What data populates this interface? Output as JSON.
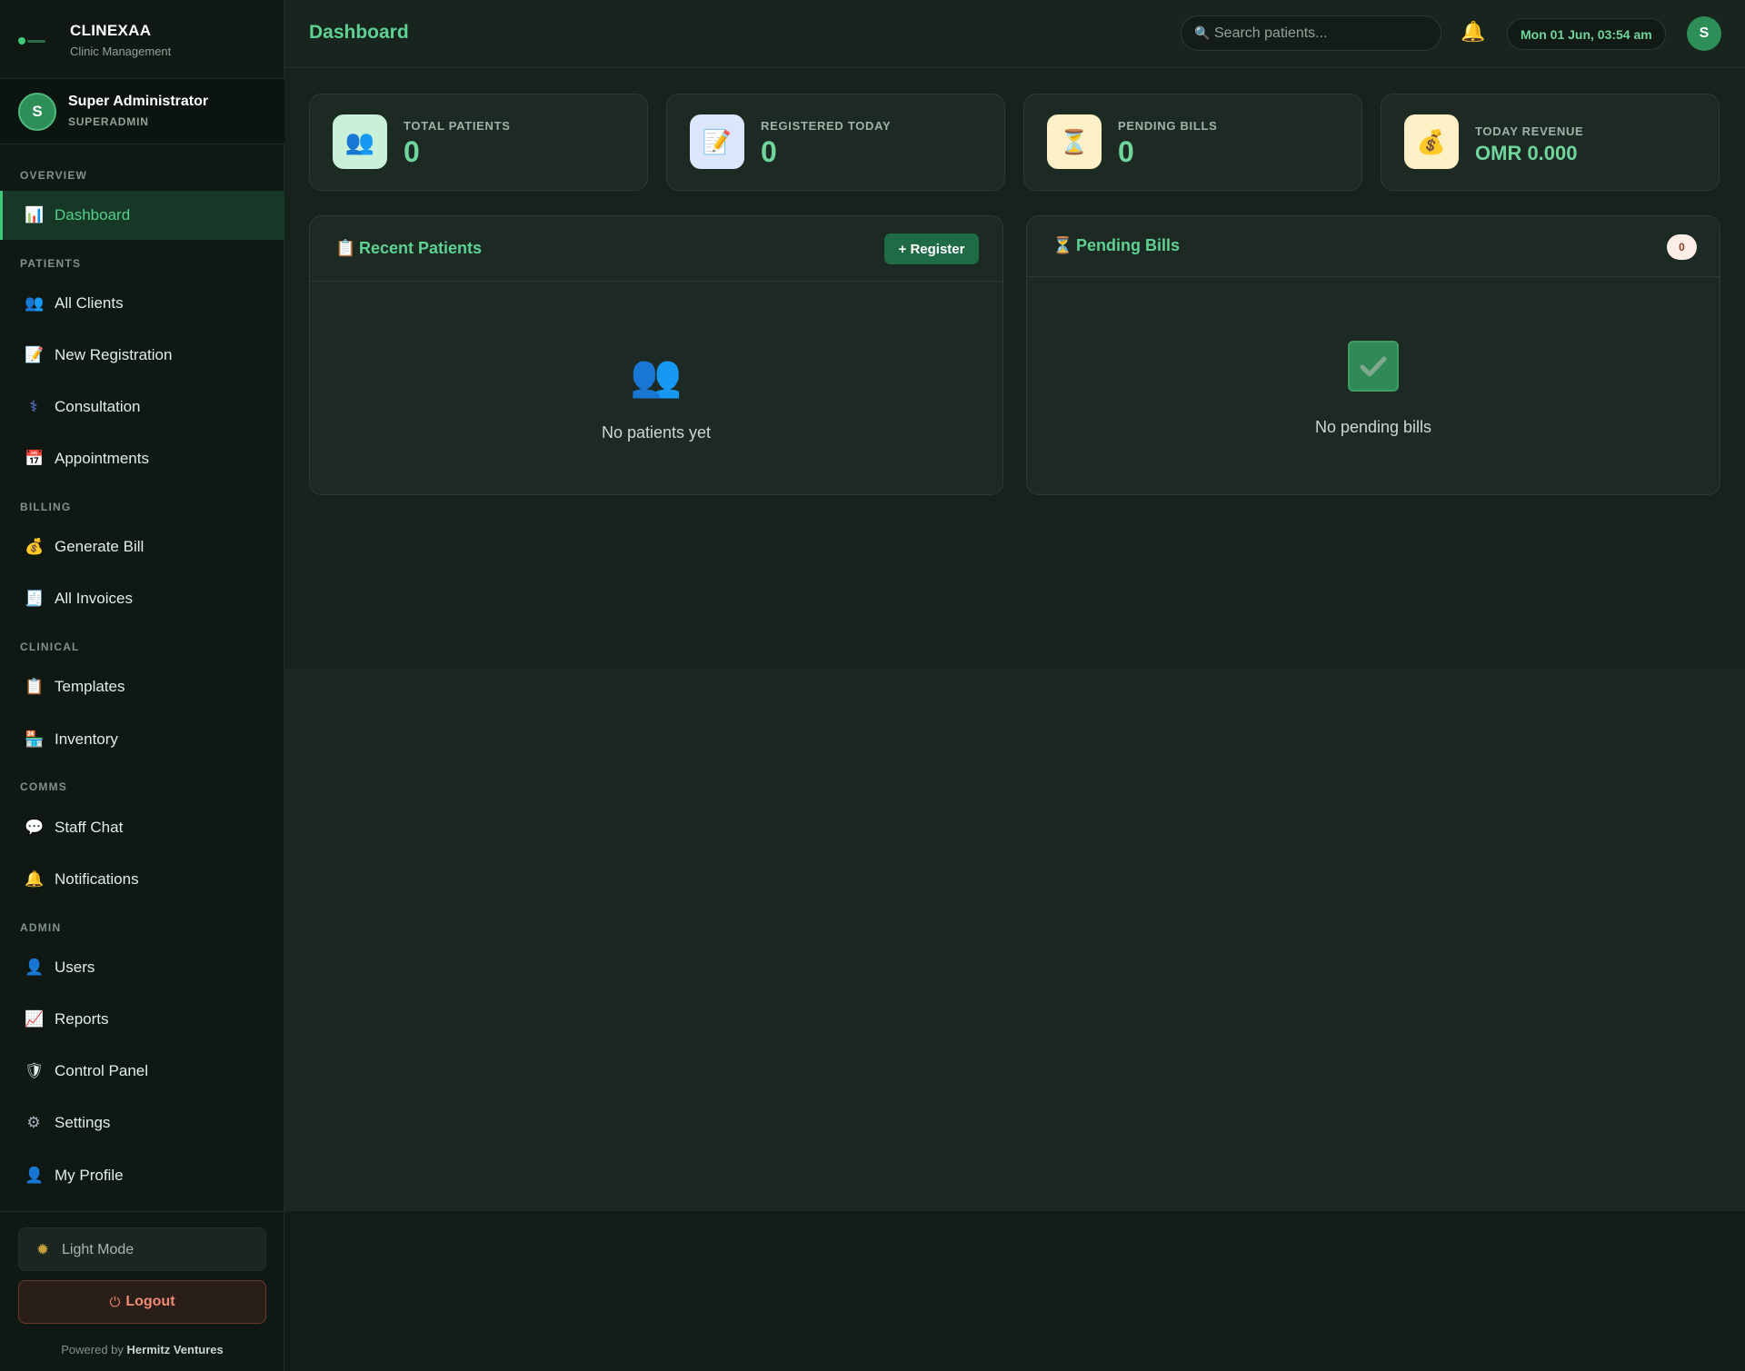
{
  "brand": {
    "name": "CLINEXAA",
    "subtitle": "Clinic Management"
  },
  "user": {
    "initial": "S",
    "name": "Super Administrator",
    "role": "SUPERADMIN"
  },
  "sidebar": {
    "sections": [
      {
        "title": "OVERVIEW"
      },
      {
        "title": "PATIENTS"
      },
      {
        "title": "BILLING"
      },
      {
        "title": "CLINICAL"
      },
      {
        "title": "COMMS"
      },
      {
        "title": "ADMIN"
      }
    ],
    "items": [
      {
        "label": "Dashboard",
        "icon": "bar-chart-icon",
        "active": true
      },
      {
        "label": "All Clients",
        "icon": "people-icon"
      },
      {
        "label": "New Registration",
        "icon": "memo-icon"
      },
      {
        "label": "Consultation",
        "icon": "stethoscope-icon"
      },
      {
        "label": "Appointments",
        "icon": "calendar-icon"
      },
      {
        "label": "Generate Bill",
        "icon": "money-bag-icon"
      },
      {
        "label": "All Invoices",
        "icon": "receipt-icon"
      },
      {
        "label": "Templates",
        "icon": "clipboard-icon"
      },
      {
        "label": "Inventory",
        "icon": "store-icon"
      },
      {
        "label": "Staff Chat",
        "icon": "speech-bubble-icon"
      },
      {
        "label": "Notifications",
        "icon": "bell-icon"
      },
      {
        "label": "Users",
        "icon": "person-icon"
      },
      {
        "label": "Reports",
        "icon": "chart-up-icon"
      },
      {
        "label": "Control Panel",
        "icon": "shield-icon"
      },
      {
        "label": "Settings",
        "icon": "gear-icon"
      },
      {
        "label": "My Profile",
        "icon": "person-icon"
      }
    ],
    "footer": {
      "theme_label": "Light Mode",
      "logout_label": "Logout",
      "powered_prefix": "Powered by",
      "powered_by": "Hermitz Ventures"
    }
  },
  "header": {
    "title": "Dashboard",
    "search_placeholder": "Search patients...",
    "datetime": "Mon 01 Jun, 03:54 am",
    "avatar_initial": "S"
  },
  "stats": [
    {
      "label": "TOTAL PATIENTS",
      "value": "0",
      "icon": "people-icon"
    },
    {
      "label": "REGISTERED TODAY",
      "value": "0",
      "icon": "memo-icon"
    },
    {
      "label": "PENDING BILLS",
      "value": "0",
      "icon": "hourglass-icon"
    },
    {
      "label": "TODAY REVENUE",
      "value": "OMR 0.000",
      "icon": "money-bag-icon"
    }
  ],
  "recent_patients": {
    "title": "Recent Patients",
    "button_label": "+ Register",
    "empty_text": "No patients yet"
  },
  "pending_bills": {
    "title": "Pending Bills",
    "count": "0",
    "empty_text": "No pending bills"
  },
  "colors": {
    "accent": "#5ed193",
    "sidebar_bg": "#0f1813",
    "main_bg": "#1c2922",
    "card_bg": "#1c2a23",
    "logout": "#f08b73"
  }
}
